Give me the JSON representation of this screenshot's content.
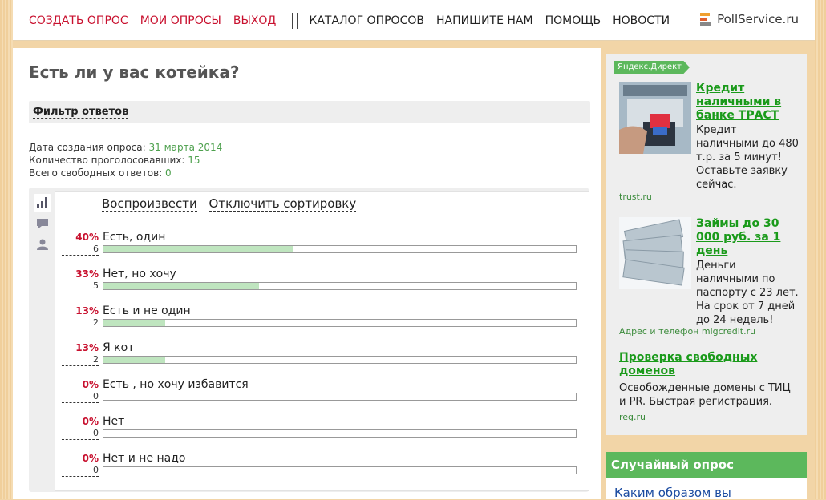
{
  "nav": {
    "left": [
      "СОЗДАТЬ ОПРОС",
      "МОИ ОПРОСЫ",
      "ВЫХОД"
    ],
    "right": [
      "КАТАЛОГ ОПРОСОВ",
      "НАПИШИТЕ НАМ",
      "ПОМОЩЬ",
      "НОВОСТИ"
    ],
    "brand": "PollService.ru"
  },
  "poll": {
    "title": "Есть ли у вас котейка?",
    "filter_label": "Фильтр ответов",
    "stats": {
      "created_label": "Дата создания опроса:",
      "created_value": "31 марта 2014",
      "voted_label": "Количество проголосовавших:",
      "voted_value": "15",
      "free_label": "Всего свободных ответов:",
      "free_value": "0"
    },
    "actions": {
      "replay": "Воспроизвести",
      "sort_off": "Отключить сортировку"
    },
    "answers": [
      {
        "label": "Есть, один",
        "percent": "40%",
        "count": "6",
        "fraction": 0.4
      },
      {
        "label": "Нет, но хочу",
        "percent": "33%",
        "count": "5",
        "fraction": 0.33
      },
      {
        "label": "Есть и не один",
        "percent": "13%",
        "count": "2",
        "fraction": 0.13
      },
      {
        "label": "Я кот",
        "percent": "13%",
        "count": "2",
        "fraction": 0.13
      },
      {
        "label": "Есть , но хочу избавится",
        "percent": "0%",
        "count": "0",
        "fraction": 0
      },
      {
        "label": "Нет",
        "percent": "0%",
        "count": "0",
        "fraction": 0
      },
      {
        "label": "Нет и не надо",
        "percent": "0%",
        "count": "0",
        "fraction": 0
      }
    ]
  },
  "sidebar": {
    "direct_badge": "Яндекс.Директ",
    "ads": [
      {
        "title": "Кредит наличными в банке ТРАСТ",
        "text": "Кредит наличными до 480 т.р. за 5 минут! Оставьте заявку сейчас.",
        "domain": "trust.ru"
      },
      {
        "title": "Займы до 30 000 руб. за 1 день",
        "text": "Деньги наличными по паспорту с 23 лет. На срок от 7 дней до 24 недель!",
        "domain": "Адрес и телефон  migcredit.ru"
      },
      {
        "title": "Проверка свободных доменов",
        "text": "Освобожденные домены с ТИЦ и PR. Быстрая регистрация.",
        "domain": "reg.ru"
      }
    ],
    "random": {
      "heading": "Случайный опрос",
      "link": "Каким образом вы"
    }
  },
  "colors": {
    "accent_red": "#c8102e",
    "accent_green": "#5cb85c",
    "bar_fill": "#bfe5bf",
    "page_bg": "#f2d5a7"
  }
}
